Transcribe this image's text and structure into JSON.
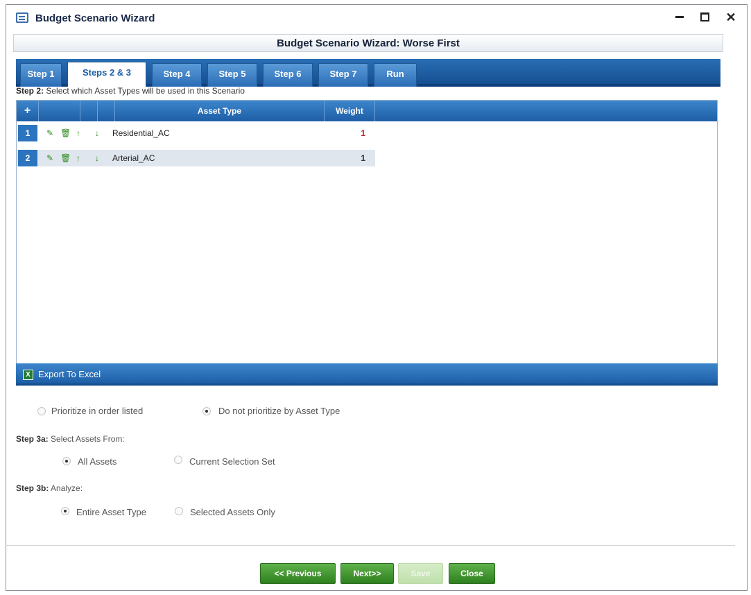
{
  "window": {
    "title": "Budget Scenario Wizard"
  },
  "header": {
    "title": "Budget Scenario Wizard: Worse First"
  },
  "tabs": [
    {
      "label": "Step 1"
    },
    {
      "label": "Steps 2 & 3"
    },
    {
      "label": "Step 4"
    },
    {
      "label": "Step 5"
    },
    {
      "label": "Step 6"
    },
    {
      "label": "Step 7"
    },
    {
      "label": "Run"
    }
  ],
  "active_tab": "Steps 2 & 3",
  "step2": {
    "prefix": "Step 2:",
    "text": "Select which Asset Types will be used in this Scenario"
  },
  "grid": {
    "add_symbol": "+",
    "columns": {
      "asset_type": "Asset Type",
      "weight": "Weight"
    },
    "rows": [
      {
        "num": "1",
        "asset_type": "Residential_AC",
        "weight": "1"
      },
      {
        "num": "2",
        "asset_type": "Arterial_AC",
        "weight": "1"
      }
    ]
  },
  "export": {
    "label": "Export To Excel"
  },
  "prioritize": {
    "option1": "Prioritize in order listed",
    "option2": "Do not prioritize by Asset Type",
    "selected": "option2"
  },
  "step3a": {
    "prefix": "Step 3a:",
    "text": "Select Assets From:",
    "option1": "All Assets",
    "option2": "Current Selection Set",
    "selected": "option1"
  },
  "step3b": {
    "prefix": "Step 3b:",
    "text": "Analyze:",
    "option1": "Entire Asset Type",
    "option2": "Selected Assets Only",
    "selected": "option1"
  },
  "buttons": {
    "previous": "<< Previous",
    "next": "Next>>",
    "save": "Save",
    "close": "Close"
  }
}
